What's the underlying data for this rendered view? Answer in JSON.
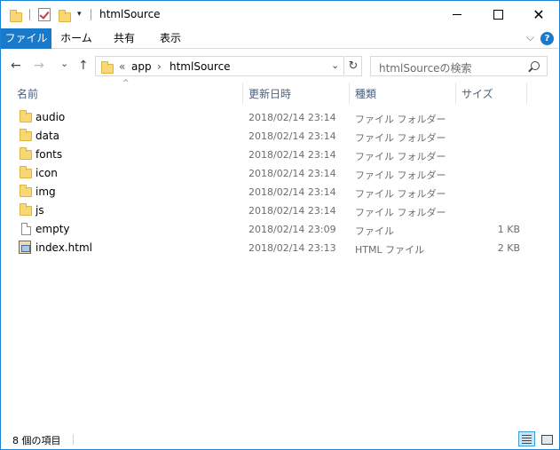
{
  "window": {
    "title": "htmlSource",
    "close_glyph": "✕",
    "qa_dropdown_glyph": "▾"
  },
  "ribbon": {
    "tabs": [
      "ファイル",
      "ホーム",
      "共有",
      "表示"
    ],
    "expand_glyph": "⌵",
    "help_glyph": "?",
    "accent_color": "#1979ca"
  },
  "nav": {
    "back_glyph": "←",
    "forward_glyph": "→",
    "recent_glyph": "⌄",
    "up_glyph": "↑",
    "breadcrumb_prefix": "«",
    "breadcrumb": [
      "app",
      "htmlSource"
    ],
    "breadcrumb_sep": "›",
    "dropdown_glyph": "⌄",
    "refresh_glyph": "↻",
    "search_placeholder": "htmlSourceの検索"
  },
  "columns": {
    "name": "名前",
    "date": "更新日時",
    "type": "種類",
    "size": "サイズ",
    "sort_glyph": "^"
  },
  "files": [
    {
      "name": "audio",
      "date": "2018/02/14 23:14",
      "type": "ファイル フォルダー",
      "size": "",
      "icon": "folder-icon"
    },
    {
      "name": "data",
      "date": "2018/02/14 23:14",
      "type": "ファイル フォルダー",
      "size": "",
      "icon": "folder-icon"
    },
    {
      "name": "fonts",
      "date": "2018/02/14 23:14",
      "type": "ファイル フォルダー",
      "size": "",
      "icon": "folder-icon"
    },
    {
      "name": "icon",
      "date": "2018/02/14 23:14",
      "type": "ファイル フォルダー",
      "size": "",
      "icon": "folder-icon"
    },
    {
      "name": "img",
      "date": "2018/02/14 23:14",
      "type": "ファイル フォルダー",
      "size": "",
      "icon": "folder-icon"
    },
    {
      "name": "js",
      "date": "2018/02/14 23:14",
      "type": "ファイル フォルダー",
      "size": "",
      "icon": "folder-icon"
    },
    {
      "name": "empty",
      "date": "2018/02/14 23:09",
      "type": "ファイル",
      "size": "1 KB",
      "icon": "file-icon"
    },
    {
      "name": "index.html",
      "date": "2018/02/14 23:13",
      "type": "HTML ファイル",
      "size": "2 KB",
      "icon": "html-file-icon"
    }
  ],
  "status": {
    "item_count": "8 個の項目"
  }
}
